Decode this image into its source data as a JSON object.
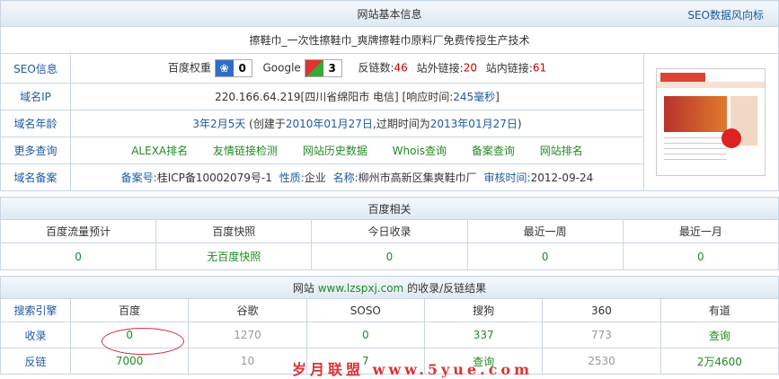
{
  "site_info": {
    "header": "网站基本信息",
    "header_link": "SEO数据风向标",
    "title": "擦鞋巾_一次性擦鞋巾_爽牌擦鞋巾原料厂免费传授生产技术",
    "seo": {
      "label": "SEO信息",
      "baidu_weight_label": "百度权重",
      "baidu_weight": "0",
      "google_label": "Google",
      "google_pr": "3",
      "backlinks_label": "反链数:",
      "backlinks": "46",
      "outlinks_label": "站外链接:",
      "outlinks": "20",
      "inlinks_label": "站内链接:",
      "inlinks": "61"
    },
    "ip": {
      "label": "域名IP",
      "value": "220.166.64.219[四川省绵阳市 电信]",
      "response_label": "[响应时间:",
      "response": "245毫秒",
      "response_end": "]"
    },
    "age": {
      "label": "域名年龄",
      "value": "3年2月5天",
      "created_label": "(创建于",
      "created": "2010年01月27日",
      "expire_label": ",过期时间为",
      "expire": "2013年01月27日",
      "end": ")"
    },
    "more": {
      "label": "更多查询",
      "links": [
        "ALEXA排名",
        "友情链接检测",
        "网站历史数据",
        "Whois查询",
        "备案查询",
        "网站排名"
      ]
    },
    "beian": {
      "label": "域名备案",
      "no_label": "备案号:",
      "no": "桂ICP备10002079号-1",
      "nature_label": "性质:",
      "nature": "企业",
      "name_label": "名称:",
      "name": "柳州市高新区集爽鞋巾厂",
      "date_label": "审核时间:",
      "date": "2012-09-24"
    }
  },
  "baidu": {
    "header": "百度相关",
    "columns": [
      "百度流量预计",
      "百度快照",
      "今日收录",
      "最近一周",
      "最近一月"
    ],
    "values": [
      "0",
      "无百度快照",
      "0",
      "0",
      "0"
    ]
  },
  "index": {
    "header_prefix": "网站",
    "domain": "www.lzspxj.com",
    "header_suffix": "的收录/反链结果",
    "columns": [
      "搜索引擎",
      "百度",
      "谷歌",
      "SOSO",
      "搜狗",
      "360",
      "有道"
    ],
    "rows": [
      {
        "label": "收录",
        "values": [
          "0",
          "1270",
          "0",
          "337",
          "773",
          "查询"
        ]
      },
      {
        "label": "反链",
        "values": [
          "7000",
          "10",
          "7",
          "查询",
          "2530",
          "2万4600"
        ]
      }
    ]
  },
  "watermark": "岁月联盟 www.5yue.com"
}
